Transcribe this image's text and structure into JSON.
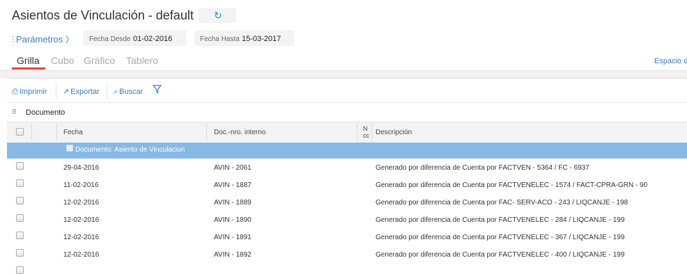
{
  "header": {
    "title": "Asientos de Vinculación - default",
    "refresh_icon": "refresh-icon"
  },
  "params": {
    "label": "Parámetros",
    "chevron": "〉",
    "date_from_label": "Fecha Desde",
    "date_from_value": "01-02-2016",
    "date_to_label": "Fecha Hasta",
    "date_to_value": "15-03-2017"
  },
  "tabs": [
    {
      "label": "Grilla",
      "active": true
    },
    {
      "label": "Cubo",
      "active": false
    },
    {
      "label": "Gráfico",
      "active": false
    },
    {
      "label": "Tablero",
      "active": false
    }
  ],
  "espacio_label": "Espacio d",
  "toolbar": {
    "print_label": "Imprimir",
    "export_label": "Exportar",
    "search_label": "Buscar"
  },
  "grouping": {
    "label": "Documento"
  },
  "grid": {
    "columns": {
      "fecha": "Fecha",
      "doc": "Doc.-nro. interno",
      "nro_top": "N",
      "nro_bottom": "cc",
      "descripcion": "Descripción"
    },
    "group_row": "Documento: Asiento de Vinculacion",
    "rows": [
      {
        "fecha": "29-04-2016",
        "doc": "AVIN - 2061",
        "descripcion": "Generado por diferencia de Cuenta por FACTVEN - 5364 / FC - 6937"
      },
      {
        "fecha": "11-02-2016",
        "doc": "AVIN - 1887",
        "descripcion": "Generado por diferencia de Cuenta por FACTVENELEC - 1574 / FACT-CPRA-GRN - 90"
      },
      {
        "fecha": "12-02-2016",
        "doc": "AVIN - 1889",
        "descripcion": "Generado por diferencia de Cuenta por FAC- SERV-ACO - 243 / LIQCANJE - 198"
      },
      {
        "fecha": "12-02-2016",
        "doc": "AVIN - 1890",
        "descripcion": "Generado por diferencia de Cuenta por FACTVENELEC - 284 / LIQCANJE - 199"
      },
      {
        "fecha": "12-02-2016",
        "doc": "AVIN - 1891",
        "descripcion": "Generado por diferencia de Cuenta por FACTVENELEC - 367 / LIQCANJE - 199"
      },
      {
        "fecha": "12-02-2016",
        "doc": "AVIN - 1892",
        "descripcion": "Generado por diferencia de Cuenta por FACTVENELEC - 400 / LIQCANJE - 199"
      }
    ]
  }
}
